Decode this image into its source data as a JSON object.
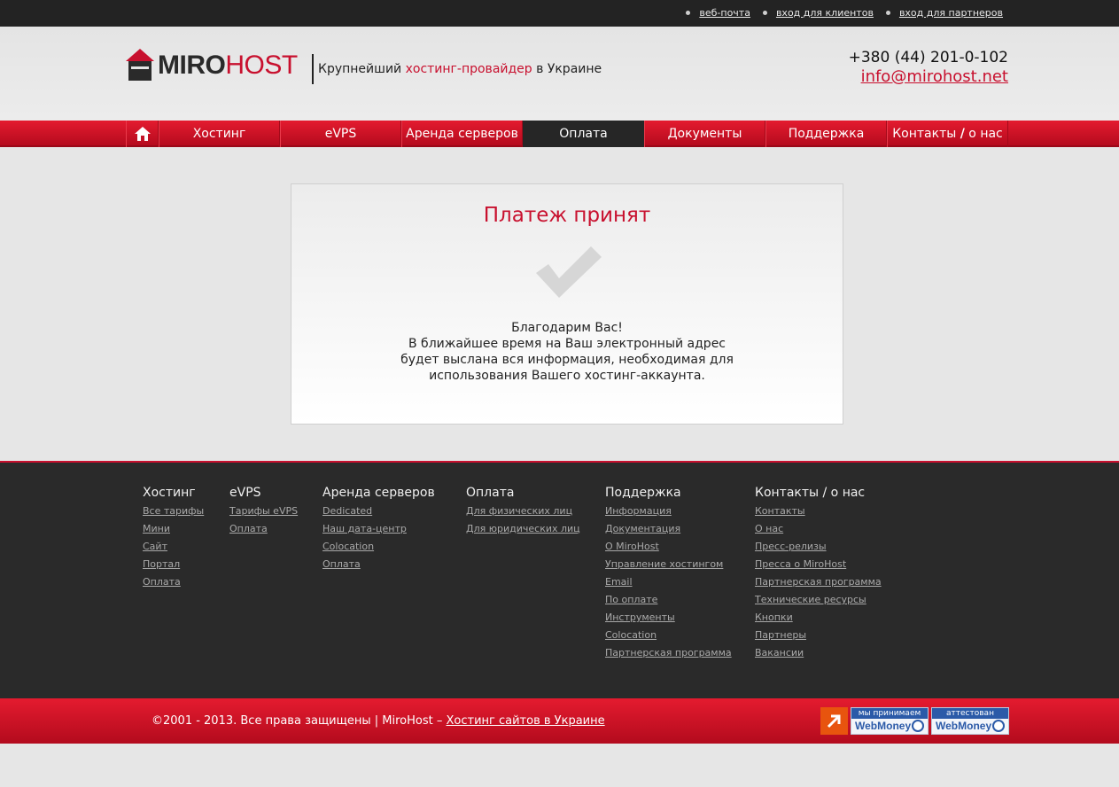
{
  "top_links": [
    "веб-почта",
    "вход для клиентов",
    "вход для партнеров"
  ],
  "logo": {
    "miro": "MIRO",
    "host": "HOST"
  },
  "tagline": {
    "pre": "Крупнейший ",
    "highlight": "хостинг-провайдер",
    "post": " в Украине"
  },
  "contact": {
    "phone": "+380 (44) 201-0-102",
    "email": "info@mirohost.net"
  },
  "nav": {
    "items": [
      {
        "label": "Хостинг"
      },
      {
        "label": "eVPS"
      },
      {
        "label": "Аренда серверов"
      },
      {
        "label": "Оплата",
        "active": true
      },
      {
        "label": "Документы"
      },
      {
        "label": "Поддержка"
      }
    ],
    "contacts_a": "Контакты ",
    "contacts_slash": "/",
    "contacts_b": " о нас"
  },
  "card": {
    "title": "Платеж принят",
    "lines": [
      "Благодарим Вас!",
      "В ближайшее время на Ваш электронный адрес",
      "будет выслана вся информация, необходимая для",
      "использования Вашего хостинг-аккаунта."
    ]
  },
  "footer": {
    "columns": [
      {
        "title": "Хостинг",
        "links": [
          "Все тарифы",
          "Мини",
          "Сайт",
          "Портал",
          "Оплата"
        ]
      },
      {
        "title": "eVPS",
        "links": [
          "Тарифы eVPS",
          "Оплата"
        ]
      },
      {
        "title": "Аренда серверов",
        "links": [
          "Dedicated",
          "Наш дата-центр",
          "Colocation",
          "Оплата"
        ]
      },
      {
        "title": "Оплата",
        "links": [
          "Для физических лиц",
          "Для юридических лиц"
        ]
      },
      {
        "title": "Поддержка",
        "links": [
          "Информация",
          "Документация",
          "О MiroHost",
          "Управление хостингом",
          "Email",
          "По оплате",
          "Инструменты",
          "Colocation",
          "Партнерская программа"
        ]
      },
      {
        "title": "Контакты / о нас",
        "links": [
          "Контакты",
          "О нас",
          "Пресс-релизы",
          "Пресса о MiroHost",
          "Партнерская программа",
          "Технические ресурсы",
          "Кнопки",
          "Партнеры",
          "Вакансии"
        ]
      }
    ]
  },
  "bottom": {
    "copyright": "©2001 - 2013. Все права защищены | MiroHost – ",
    "copyright_link": "Хостинг сайтов в Украине",
    "badges": [
      {
        "top": "мы принимаем",
        "bottom": "WebMoney"
      },
      {
        "top": "аттестован",
        "bottom": "WebMoney"
      }
    ]
  },
  "colors": {
    "brand_red": "#c8102e",
    "dark": "#2a2a2a"
  }
}
